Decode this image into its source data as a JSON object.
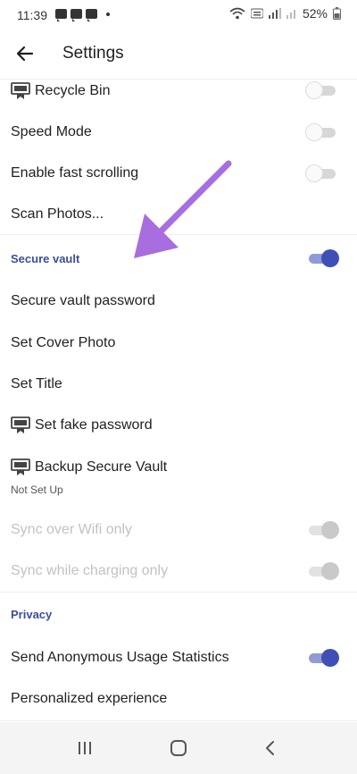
{
  "status_bar": {
    "time": "11:39",
    "battery": "52%",
    "notification_icons": [
      "message-icon",
      "chat-icon",
      "chat-icon"
    ]
  },
  "header": {
    "title": "Settings"
  },
  "rows": {
    "recycle_bin": {
      "label": "Recycle Bin",
      "enabled": false
    },
    "speed_mode": {
      "label": "Speed Mode",
      "enabled": false
    },
    "fast_scrolling": {
      "label": "Enable fast scrolling",
      "enabled": false
    },
    "scan_photos": {
      "label": "Scan Photos..."
    },
    "secure_vault": {
      "label": "Secure vault",
      "enabled": true
    },
    "vault_password": {
      "label": "Secure vault password"
    },
    "cover_photo": {
      "label": "Set Cover Photo"
    },
    "set_title": {
      "label": "Set Title"
    },
    "fake_password": {
      "label": "Set fake password"
    },
    "backup_vault": {
      "label": "Backup Secure Vault",
      "sublabel": "Not Set Up"
    },
    "sync_wifi": {
      "label": "Sync over Wifi only",
      "enabled": true,
      "disabled": true
    },
    "sync_charging": {
      "label": "Sync while charging only",
      "enabled": true,
      "disabled": true
    },
    "privacy": {
      "label": "Privacy"
    },
    "usage_stats": {
      "label": "Send Anonymous Usage Statistics",
      "enabled": true
    },
    "personalized": {
      "label": "Personalized experience"
    }
  },
  "colors": {
    "accent": "#3f4fb5",
    "section_header": "#3a4f9c",
    "annotation_arrow": "#a86ee0"
  }
}
